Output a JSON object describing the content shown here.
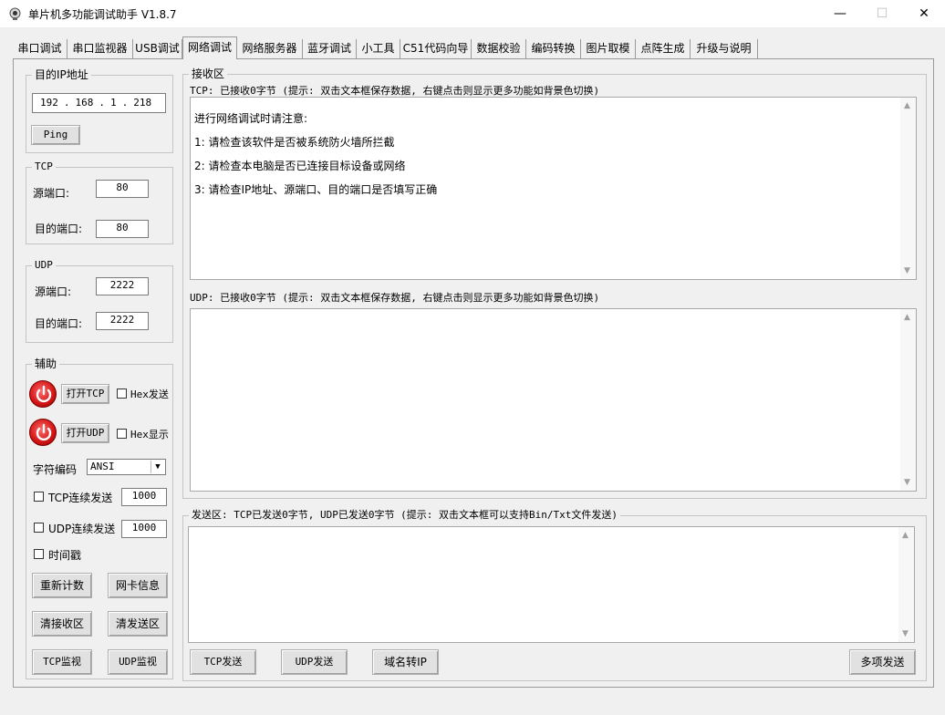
{
  "window": {
    "title": "单片机多功能调试助手 V1.8.7",
    "minimize": "—",
    "maximize": "☐",
    "close": "✕"
  },
  "tabs": [
    {
      "label": "串口调试"
    },
    {
      "label": "串口监视器"
    },
    {
      "label": "USB调试"
    },
    {
      "label": "网络调试",
      "active": true
    },
    {
      "label": "网络服务器"
    },
    {
      "label": "蓝牙调试"
    },
    {
      "label": "小工具"
    },
    {
      "label": "C51代码向导"
    },
    {
      "label": "数据校验"
    },
    {
      "label": "编码转换"
    },
    {
      "label": "图片取模"
    },
    {
      "label": "点阵生成"
    },
    {
      "label": "升级与说明"
    }
  ],
  "target_ip": {
    "group_title": "目的IP地址",
    "octets": [
      "192",
      "168",
      "1",
      "218"
    ],
    "ping_label": "Ping"
  },
  "tcp": {
    "group_title": "TCP",
    "src_port_label": "源端口:",
    "src_port": "80",
    "dst_port_label": "目的端口:",
    "dst_port": "80"
  },
  "udp": {
    "group_title": "UDP",
    "src_port_label": "源端口:",
    "src_port": "2222",
    "dst_port_label": "目的端口:",
    "dst_port": "2222"
  },
  "aux": {
    "group_title": "辅助",
    "open_tcp": "打开TCP",
    "hex_send": "Hex发送",
    "open_udp": "打开UDP",
    "hex_display": "Hex显示",
    "charset_label": "字符编码",
    "charset_value": "ANSI",
    "tcp_continuous": "TCP连续发送",
    "tcp_interval": "1000",
    "udp_continuous": "UDP连续发送",
    "udp_interval": "1000",
    "timestamp": "时间戳",
    "recount": "重新计数",
    "nic_info": "网卡信息",
    "clear_recv": "清接收区",
    "clear_send": "清发送区",
    "tcp_monitor": "TCP监视",
    "udp_monitor": "UDP监视"
  },
  "receive": {
    "group_title": "接收区",
    "tcp_status": "TCP: 已接收0字节 (提示: 双击文本框保存数据, 右键点击则显示更多功能如背景色切换)",
    "tcp_lines": [
      "进行网络调试时请注意:",
      "1: 请检查该软件是否被系统防火墙所拦截",
      "2: 请检查本电脑是否已连接目标设备或网络",
      "3: 请检查IP地址、源端口、目的端口是否填写正确"
    ],
    "udp_status": "UDP: 已接收0字节 (提示: 双击文本框保存数据, 右键点击则显示更多功能如背景色切换)"
  },
  "send": {
    "group_title": "发送区: TCP已发送0字节, UDP已发送0字节 (提示: 双击文本框可以支持Bin/Txt文件发送)",
    "tcp_send": "TCP发送",
    "udp_send": "UDP发送",
    "domain_to_ip": "域名转IP",
    "multi_send": "多项发送"
  }
}
